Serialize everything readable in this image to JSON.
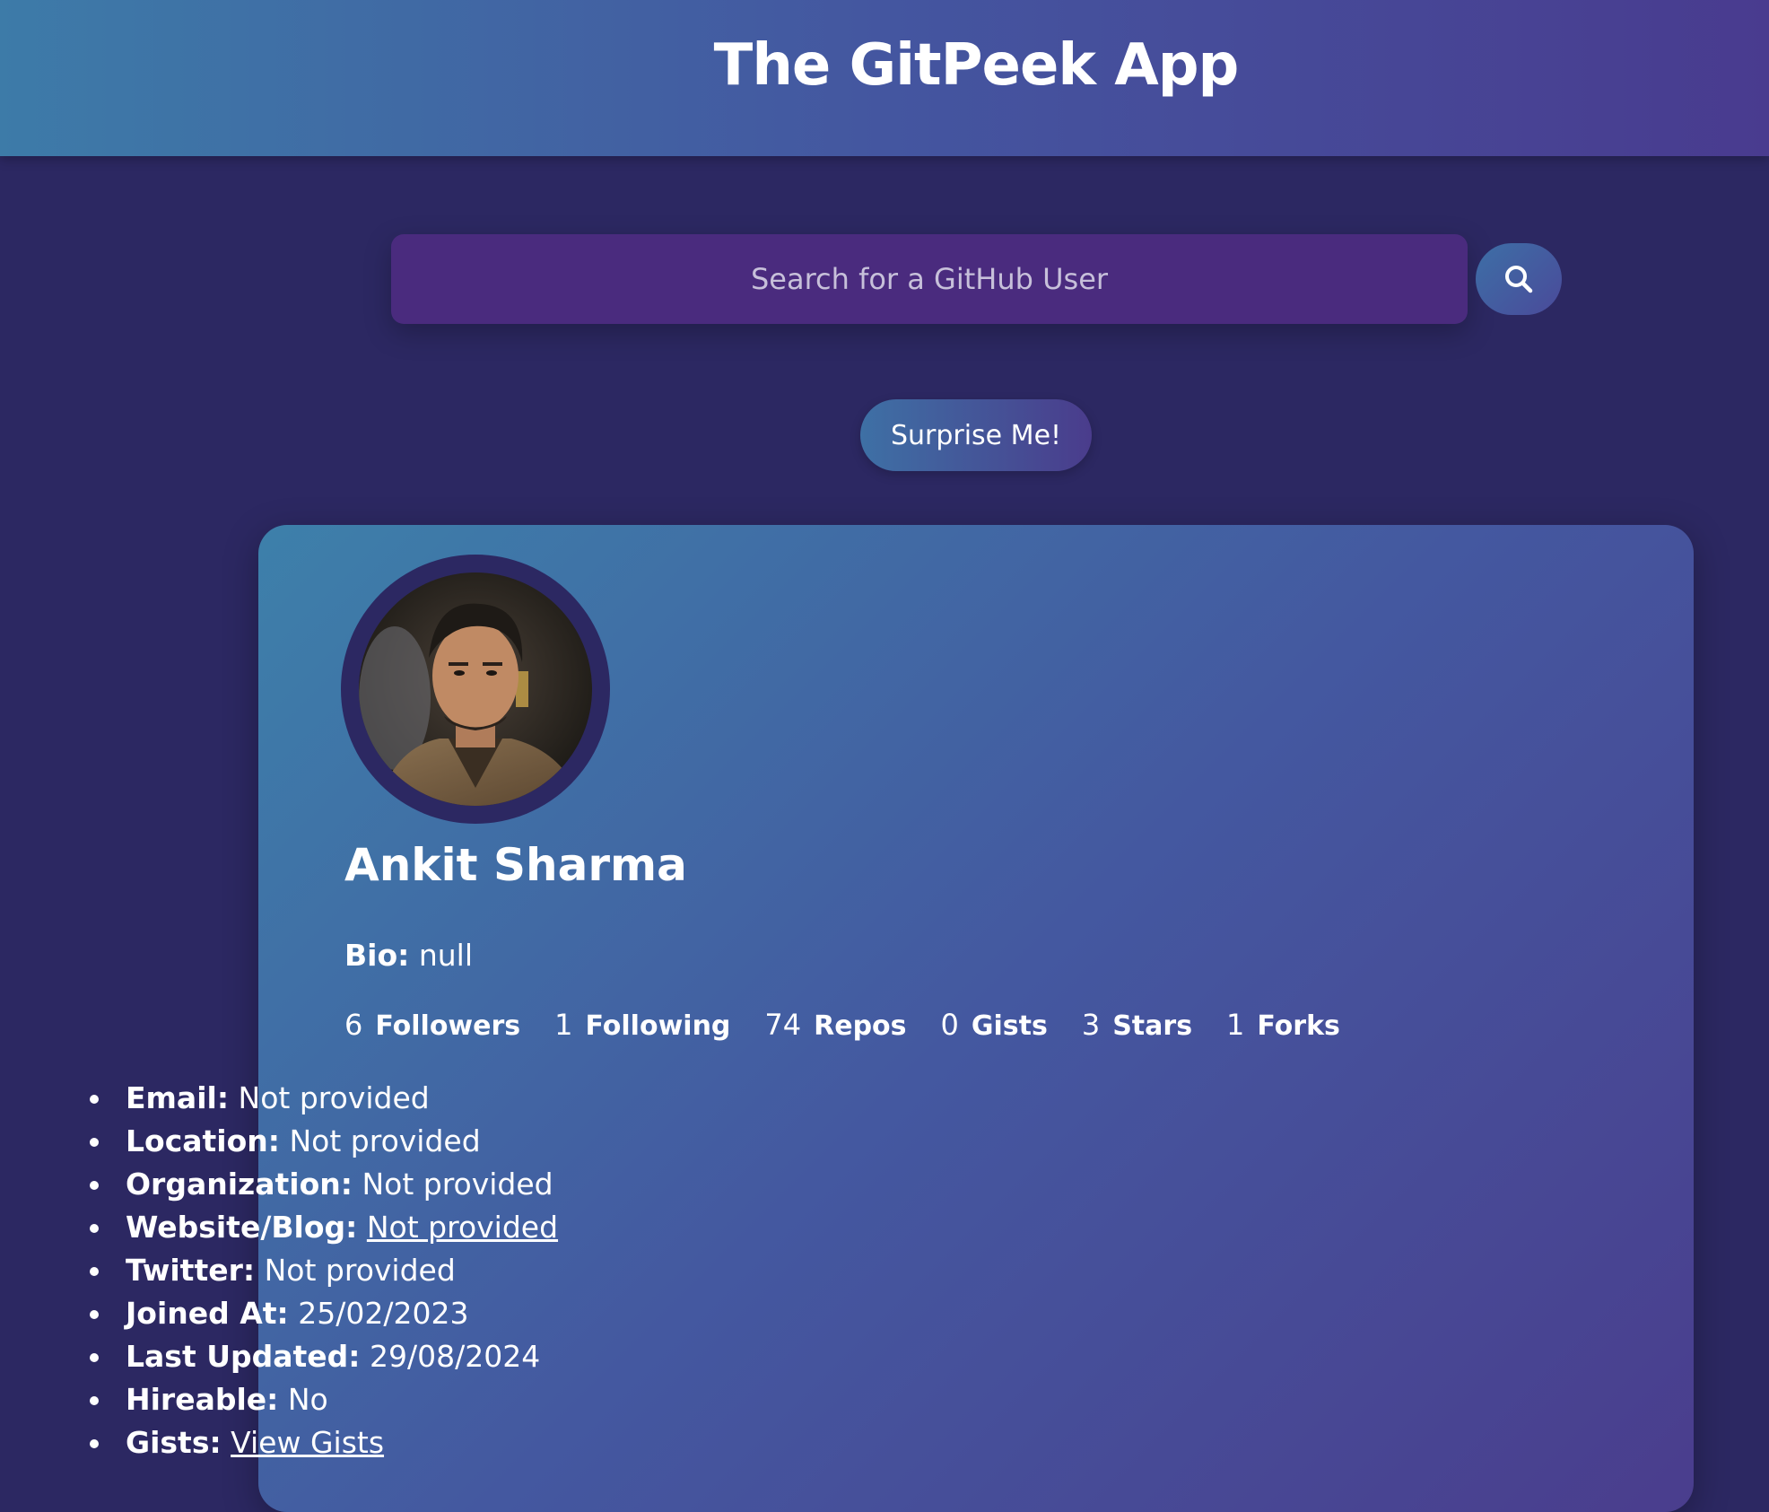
{
  "header": {
    "title": "The GitPeek App"
  },
  "search": {
    "placeholder": "Search for a GitHub User",
    "value": "",
    "button_icon": "search-icon"
  },
  "surprise": {
    "label": "Surprise Me!"
  },
  "profile": {
    "name": "Ankit Sharma",
    "bio_label": "Bio:",
    "bio_value": "null",
    "stats": [
      {
        "value": "6",
        "label": "Followers"
      },
      {
        "value": "1",
        "label": "Following"
      },
      {
        "value": "74",
        "label": "Repos"
      },
      {
        "value": "0",
        "label": "Gists"
      },
      {
        "value": "3",
        "label": "Stars"
      },
      {
        "value": "1",
        "label": "Forks"
      }
    ],
    "details": [
      {
        "label": "Email:",
        "value": "Not provided"
      },
      {
        "label": "Location:",
        "value": "Not provided"
      },
      {
        "label": "Organization:",
        "value": "Not provided"
      },
      {
        "label": "Website/Blog:",
        "value": "Not provided"
      },
      {
        "label": "Twitter:",
        "value": "Not provided"
      },
      {
        "label": "Joined At:",
        "value": "25/02/2023"
      },
      {
        "label": "Last Updated:",
        "value": "29/08/2024"
      },
      {
        "label": "Hireable:",
        "value": "No"
      },
      {
        "label": "Gists:",
        "value": "View Gists"
      }
    ]
  },
  "colors": {
    "background": "#2c2862",
    "header_gradient_start": "#3d7ba8",
    "header_gradient_end": "#493b8f",
    "search_field": "#4a2b7e",
    "card_gradient_start": "#3d80aa",
    "card_gradient_end": "#4a3d8d",
    "text": "#ffffff"
  }
}
